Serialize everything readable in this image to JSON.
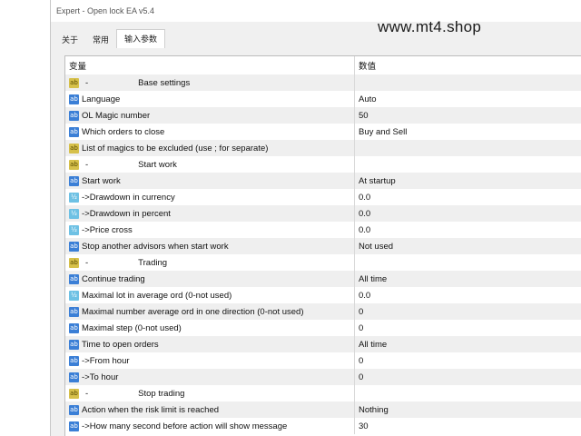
{
  "window": {
    "title": "Expert - Open lock EA v5.4"
  },
  "tabs": [
    {
      "label": "关于",
      "active": false
    },
    {
      "label": "常用",
      "active": false
    },
    {
      "label": "输入参数",
      "active": true
    }
  ],
  "watermark": "www.mt4.shop",
  "grid": {
    "col_variable": "变量",
    "col_value": "数值",
    "rows": [
      {
        "type": "section",
        "icon": "string-icon",
        "dash": "-",
        "name": "Base settings",
        "value": ""
      },
      {
        "type": "param",
        "icon": "enum-icon",
        "name": "Language",
        "value": "Auto"
      },
      {
        "type": "param",
        "icon": "enum-icon",
        "name": "OL Magic number",
        "value": "50"
      },
      {
        "type": "param",
        "icon": "enum-icon",
        "name": "Which orders to close",
        "value": "Buy and Sell"
      },
      {
        "type": "param",
        "icon": "string-icon",
        "name": "List of magics to be excluded (use ; for separate)",
        "value": ""
      },
      {
        "type": "section",
        "icon": "string-icon",
        "dash": "-",
        "name": "Start work",
        "value": ""
      },
      {
        "type": "param",
        "icon": "enum-icon",
        "name": "Start work",
        "value": "At startup"
      },
      {
        "type": "param",
        "icon": "number-icon",
        "name": "->Drawdown in currency",
        "value": "0.0"
      },
      {
        "type": "param",
        "icon": "number-icon",
        "name": "->Drawdown in percent",
        "value": "0.0"
      },
      {
        "type": "param",
        "icon": "number-icon",
        "name": "->Price cross",
        "value": "0.0"
      },
      {
        "type": "param",
        "icon": "enum-icon",
        "name": "Stop another advisors when start work",
        "value": "Not used"
      },
      {
        "type": "section",
        "icon": "string-icon",
        "dash": "-",
        "name": "Trading",
        "value": ""
      },
      {
        "type": "param",
        "icon": "enum-icon",
        "name": "Continue trading",
        "value": "All time"
      },
      {
        "type": "param",
        "icon": "number-icon",
        "name": "Maximal lot in average ord (0-not used)",
        "value": "0.0"
      },
      {
        "type": "param",
        "icon": "enum-icon",
        "name": "Maximal number average ord in one direction (0-not used)",
        "value": "0"
      },
      {
        "type": "param",
        "icon": "enum-icon",
        "name": "Maximal step (0-not used)",
        "value": "0"
      },
      {
        "type": "param",
        "icon": "enum-icon",
        "name": "Time to open orders",
        "value": "All time"
      },
      {
        "type": "param",
        "icon": "enum-icon",
        "name": "->From hour",
        "value": "0"
      },
      {
        "type": "param",
        "icon": "enum-icon",
        "name": "->To hour",
        "value": "0"
      },
      {
        "type": "section",
        "icon": "string-icon",
        "dash": "-",
        "name": "Stop trading",
        "value": ""
      },
      {
        "type": "param",
        "icon": "enum-icon",
        "name": "Action when the risk limit is reached",
        "value": "Nothing"
      },
      {
        "type": "param",
        "icon": "enum-icon",
        "name": "->How many second before action will show message",
        "value": "30"
      }
    ]
  },
  "icon_glyphs": {
    "enum-icon": "ab",
    "number-icon": "½",
    "string-icon": "ab"
  },
  "colors": {
    "enum": "#3b7fd6",
    "number": "#6ec1e4",
    "string": "#d6c04a",
    "row_alt": "#efefef"
  }
}
